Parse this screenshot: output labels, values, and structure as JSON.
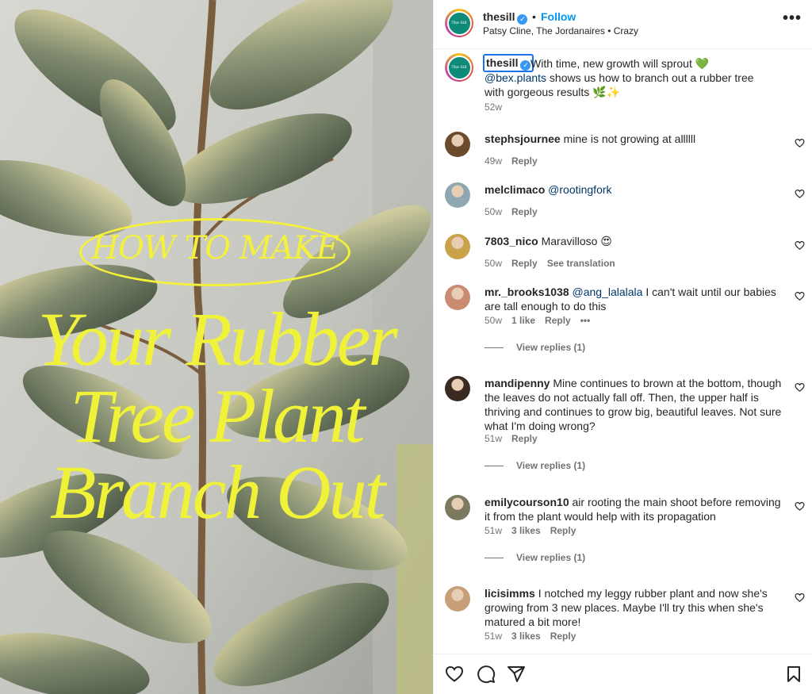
{
  "post_image": {
    "howto_text": "HOW TO MAKE",
    "headline_line1": "Your Rubber",
    "headline_line2": "Tree Plant",
    "headline_line3": "Branch Out"
  },
  "header": {
    "username": "thesill",
    "dot": "•",
    "follow_label": "Follow",
    "song": "Patsy Cline, The Jordanaires • Crazy",
    "more_label": "•••",
    "avatar_text": "The Sill"
  },
  "caption": {
    "username": "thesill",
    "text_before": "With time, new growth will sprout 💚 ",
    "mention": "@bex.plants",
    "text_after": " shows us how to branch out a rubber tree with gorgeous results 🌿✨",
    "time": "52w"
  },
  "comments": [
    {
      "user": "stephsjournee",
      "mention": "",
      "text": "mine is not growing at allllll",
      "time": "49w",
      "likes": "",
      "reply": "Reply",
      "extra": "",
      "view_replies": ""
    },
    {
      "user": "melclimaco",
      "mention": "@rootingfork",
      "text": "",
      "time": "50w",
      "likes": "",
      "reply": "Reply",
      "extra": "",
      "view_replies": ""
    },
    {
      "user": "7803_nico",
      "mention": "",
      "text": "Maravilloso 😍",
      "time": "50w",
      "likes": "",
      "reply": "Reply",
      "extra": "See translation",
      "view_replies": ""
    },
    {
      "user": "mr._brooks1038",
      "mention": "@ang_lalalala",
      "text": " I can't wait until our babies are tall enough to do this",
      "time": "50w",
      "likes": "1 like",
      "reply": "Reply",
      "extra": "•••",
      "view_replies": "View replies (1)"
    },
    {
      "user": "mandipenny",
      "mention": "",
      "text": "Mine continues to brown at the bottom, though the leaves do not actually fall off. Then, the upper half is thriving and continues to grow big, beautiful leaves. Not sure what I'm doing wrong?",
      "time": "51w",
      "likes": "",
      "reply": "Reply",
      "extra": "",
      "view_replies": "View replies (1)"
    },
    {
      "user": "emilycourson10",
      "mention": "",
      "text": "air rooting the main shoot before removing it from the plant would help with its propagation",
      "time": "51w",
      "likes": "3 likes",
      "reply": "Reply",
      "extra": "",
      "view_replies": "View replies (1)"
    },
    {
      "user": "licisimms",
      "mention": "",
      "text": "I notched my leggy rubber plant and now she's growing from 3 new places. Maybe I'll try this when she's matured a bit more!",
      "time": "51w",
      "likes": "3 likes",
      "reply": "Reply",
      "extra": "",
      "view_replies": ""
    }
  ],
  "actions": [
    "heart-icon",
    "comment-icon",
    "share-icon",
    "bookmark-icon"
  ],
  "colors": {
    "accent": "#0095f6",
    "headline": "#f0f23a",
    "mention": "#00376b"
  }
}
